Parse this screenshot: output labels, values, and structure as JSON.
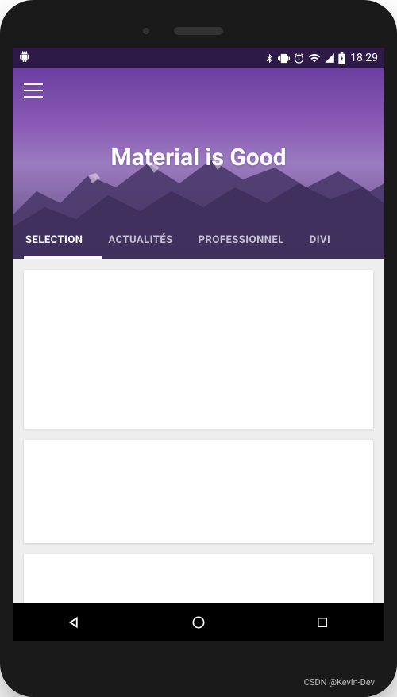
{
  "status": {
    "time": "18:29",
    "icons": {
      "bluetooth": "bluetooth",
      "vibrate": "vibrate",
      "alarm": "alarm",
      "wifi": "wifi",
      "signal": "signal",
      "battery": "battery-charging"
    }
  },
  "header": {
    "title": "Material is Good"
  },
  "tabs": [
    {
      "label": "SELECTION",
      "active": true
    },
    {
      "label": "ACTUALITÉS",
      "active": false
    },
    {
      "label": "PROFESSIONNEL",
      "active": false
    },
    {
      "label": "DIVI",
      "active": false
    }
  ],
  "nav": {
    "back": "back",
    "home": "home",
    "recent": "recent"
  },
  "watermark": "CSDN @Kevin-Dev"
}
